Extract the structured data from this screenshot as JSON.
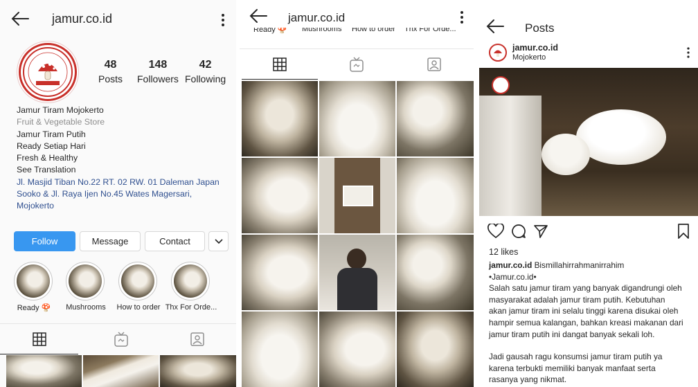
{
  "profile_screen": {
    "username": "jamur.co.id",
    "stats": [
      {
        "value": "48",
        "label": "Posts"
      },
      {
        "value": "148",
        "label": "Followers"
      },
      {
        "value": "42",
        "label": "Following"
      }
    ],
    "bio": {
      "name": "Jamur Tiram Mojokerto",
      "category": "Fruit & Vegetable Store",
      "lines": [
        "Jamur Tiram Putih",
        "Ready Setiap Hari",
        "Fresh & Healthy"
      ],
      "see_translation": "See Translation",
      "address": "Jl. Masjid Tiban No.22 RT. 02 RW. 01 Daleman Japan Sooko  & Jl. Raya Ijen No.45 Wates Magersari, Mojokerto"
    },
    "buttons": {
      "follow": "Follow",
      "message": "Message",
      "contact": "Contact"
    },
    "highlights": [
      {
        "label": "Ready 🍄"
      },
      {
        "label": "Mushrooms"
      },
      {
        "label": "How to order"
      },
      {
        "label": "Thx For Orde..."
      }
    ]
  },
  "grid_screen": {
    "username": "jamur.co.id",
    "highlight_labels": [
      "Ready 🍄",
      "Mushrooms",
      "How to order",
      "Thx For Orde..."
    ]
  },
  "post_screen": {
    "title": "Posts",
    "username": "jamur.co.id",
    "location": "Mojokerto",
    "likes": "12 likes",
    "caption_user": "jamur.co.id",
    "caption_first": "Bismillahirrahmanirrahim",
    "caption_lines": [
      "•Jamur.co.id•",
      "Salah satu jamur tiram yang banyak digandrungi oleh",
      "masyarakat adalah jamur tiram putih. Kebutuhan",
      "akan jamur tiram ini selalu tinggi karena disukai oleh",
      "hampir semua kalangan, bahkan kreasi makanan dari",
      "jamur tiram putih ini dangat banyak sekali loh."
    ],
    "caption_lines_2": [
      "Jadi gausah ragu konsumsi jamur tiram putih ya",
      "karena terbukti memiliki banyak manfaat serta",
      "rasanya yang nikmat."
    ]
  },
  "colors": {
    "accent": "#3897f0",
    "link": "#2f4f8f",
    "logo_red": "#c8302a"
  }
}
